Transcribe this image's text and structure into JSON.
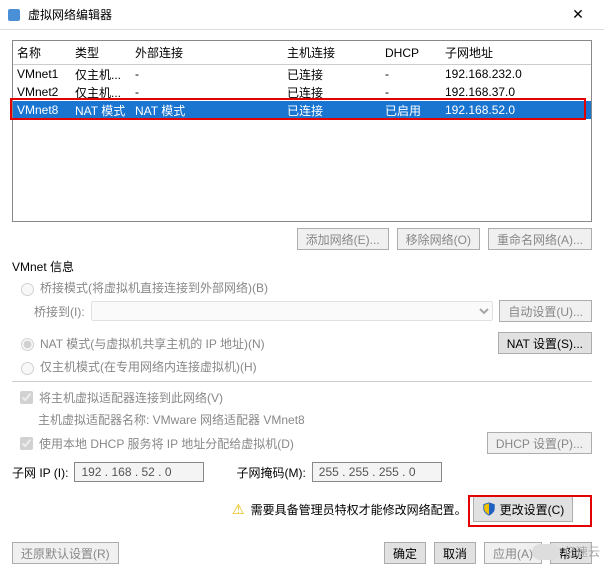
{
  "window": {
    "title": "虚拟网络编辑器",
    "close": "✕"
  },
  "table": {
    "headers": {
      "name": "名称",
      "type": "类型",
      "ext": "外部连接",
      "host": "主机连接",
      "dhcp": "DHCP",
      "subnet": "子网地址"
    },
    "rows": [
      {
        "name": "VMnet1",
        "type": "仅主机...",
        "ext": "-",
        "host": "已连接",
        "dhcp": "-",
        "subnet": "192.168.232.0",
        "sel": false
      },
      {
        "name": "VMnet2",
        "type": "仅主机...",
        "ext": "-",
        "host": "已连接",
        "dhcp": "-",
        "subnet": "192.168.37.0",
        "sel": false
      },
      {
        "name": "VMnet8",
        "type": "NAT 模式",
        "ext": "NAT 模式",
        "host": "已连接",
        "dhcp": "已启用",
        "subnet": "192.168.52.0",
        "sel": true
      }
    ]
  },
  "buttons": {
    "add": "添加网络(E)...",
    "remove": "移除网络(O)",
    "rename": "重命名网络(A)...",
    "auto": "自动设置(U)...",
    "nat": "NAT 设置(S)...",
    "dhcp": "DHCP 设置(P)...",
    "change": "更改设置(C)",
    "restore": "还原默认设置(R)",
    "ok": "确定",
    "cancel": "取消",
    "apply": "应用(A)",
    "help": "帮助"
  },
  "labels": {
    "vmnet_info": "VMnet 信息",
    "bridge": "桥接模式(将虚拟机直接连接到外部网络)(B)",
    "bridge_to": "桥接到(I):",
    "nat": "NAT 模式(与虚拟机共享主机的 IP 地址)(N)",
    "hostonly": "仅主机模式(在专用网络内连接虚拟机)(H)",
    "host_adapter": "将主机虚拟适配器连接到此网络(V)",
    "host_adapter_name": "主机虚拟适配器名称: VMware 网络适配器 VMnet8",
    "use_dhcp": "使用本地 DHCP 服务将 IP 地址分配给虚拟机(D)",
    "subnet_ip": "子网 IP (I):",
    "subnet_mask": "子网掩码(M):",
    "warning": "需要具备管理员特权才能修改网络配置。"
  },
  "values": {
    "subnet_ip": "192 . 168 . 52 . 0",
    "subnet_mask": "255 . 255 . 255 . 0"
  },
  "watermark": "亿速云"
}
